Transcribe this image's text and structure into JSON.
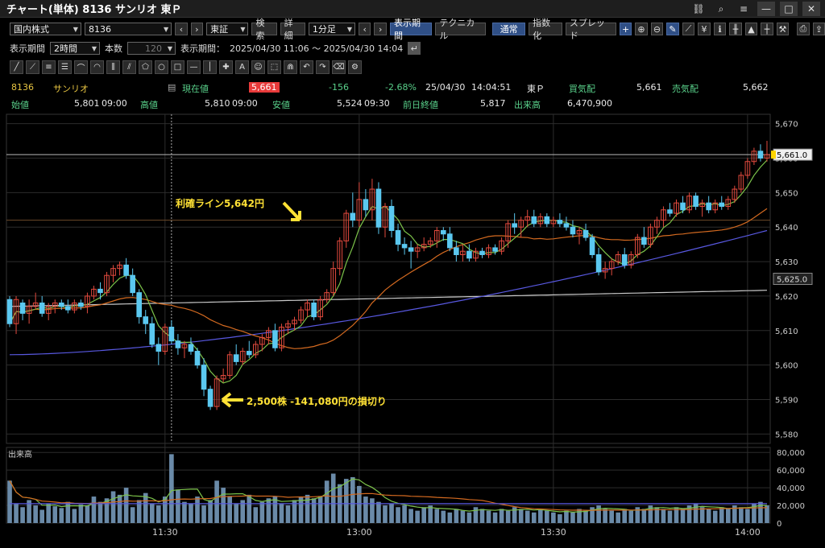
{
  "window": {
    "title": "チャート(単体) 8136 サンリオ 東Ｐ",
    "icons": [
      "link-icon",
      "search-icon",
      "menu-icon",
      "minimize-icon",
      "maximize-icon",
      "close-icon"
    ]
  },
  "toolbar1": {
    "market_select": "国内株式",
    "code_select": "8136",
    "exchange_select": "東証",
    "search_btn": "検索",
    "detail_btn": "詳細",
    "interval_select": "1分足",
    "period_btn": "表示期間",
    "technical_btn": "テクニカル",
    "normal_btn": "通常",
    "index_btn": "指数化",
    "spread_btn": "スプレッド"
  },
  "toolbar2": {
    "period_label": "表示期間",
    "period_value": "2時間",
    "count_label": "本数",
    "count_value": "120",
    "range_label": "表示期間：",
    "range_value": "2025/04/30 11:06 ～ 2025/04/30 14:04"
  },
  "quote1": {
    "code": "8136",
    "name": "サンリオ",
    "current_label": "現在値",
    "current_value": "5,661",
    "change": "-156",
    "change_pct": "-2.68%",
    "date": "25/04/30",
    "time": "14:04:51",
    "exchange": "東Ｐ",
    "bid_label": "買気配",
    "bid_value": "5,661",
    "ask_label": "売気配",
    "ask_value": "5,662"
  },
  "quote2": {
    "open_label": "始値",
    "open_value": "5,801",
    "open_time": "09:00",
    "high_label": "高値",
    "high_value": "5,810",
    "high_time": "09:00",
    "low_label": "安値",
    "low_value": "5,524",
    "low_time": "09:30",
    "prev_label": "前日終値",
    "prev_value": "5,817",
    "volume_label": "出来高",
    "volume_value": "6,470,900"
  },
  "annotations": {
    "take_profit": "利確ライン5,642円",
    "stop_loss": "2,500株 -141,080円の損切り"
  },
  "colors": {
    "up": "#e24a3e",
    "down": "#5bc8f0",
    "ma_short": "#7cc34a",
    "ma_mid": "#d46a20",
    "ma_long": "#5858e0",
    "ma_longest": "#c8c8c8",
    "annotation": "#ffe135"
  },
  "chart_data": {
    "type": "candlestick",
    "volume_label": "出来高",
    "price_ylim": [
      5578,
      5672
    ],
    "price_ticks": [
      "5,670",
      "5,660",
      "5,650",
      "5,640",
      "5,630",
      "5,620",
      "5,610",
      "5,600",
      "5,590",
      "5,580"
    ],
    "price_tick_values": [
      5670,
      5660,
      5650,
      5640,
      5630,
      5620,
      5610,
      5600,
      5590,
      5580
    ],
    "volume_ylim": [
      0,
      82000
    ],
    "volume_ticks": [
      "80,000",
      "60,000",
      "40,000",
      "20,000",
      "0"
    ],
    "volume_tick_values": [
      80000,
      60000,
      40000,
      20000,
      0
    ],
    "x_ticks": [
      "11:30",
      "13:00",
      "13:30",
      "14:00"
    ],
    "x_tick_index": [
      24,
      54,
      84,
      114
    ],
    "crosshair_index": 25,
    "price_marker": "5,661.0",
    "price_marker_value": 5661,
    "low_marker": "5,625.0",
    "low_marker_value": 5625,
    "take_profit_value": 5642,
    "candles": [
      [
        5619,
        5620,
        5611,
        5612
      ],
      [
        5612,
        5620,
        5609,
        5619
      ],
      [
        5618,
        5619,
        5613,
        5615
      ],
      [
        5615,
        5619,
        5612,
        5617
      ],
      [
        5617,
        5621,
        5616,
        5618
      ],
      [
        5618,
        5620,
        5614,
        5615
      ],
      [
        5615,
        5618,
        5613,
        5617
      ],
      [
        5617,
        5619,
        5615,
        5618
      ],
      [
        5618,
        5619,
        5616,
        5617
      ],
      [
        5617,
        5619,
        5615,
        5616
      ],
      [
        5616,
        5619,
        5615,
        5618
      ],
      [
        5618,
        5619,
        5616,
        5617
      ],
      [
        5617,
        5621,
        5615,
        5620
      ],
      [
        5620,
        5623,
        5619,
        5622
      ],
      [
        5622,
        5624,
        5619,
        5621
      ],
      [
        5621,
        5627,
        5620,
        5626
      ],
      [
        5626,
        5629,
        5624,
        5628
      ],
      [
        5628,
        5630,
        5626,
        5629
      ],
      [
        5629,
        5631,
        5625,
        5626
      ],
      [
        5626,
        5628,
        5620,
        5621
      ],
      [
        5621,
        5622,
        5612,
        5614
      ],
      [
        5614,
        5616,
        5609,
        5612
      ],
      [
        5612,
        5614,
        5605,
        5606
      ],
      [
        5606,
        5608,
        5600,
        5604
      ],
      [
        5604,
        5612,
        5603,
        5611
      ],
      [
        5611,
        5613,
        5606,
        5607
      ],
      [
        5607,
        5609,
        5603,
        5605
      ],
      [
        5605,
        5607,
        5602,
        5606
      ],
      [
        5606,
        5608,
        5603,
        5604
      ],
      [
        5604,
        5605,
        5599,
        5600
      ],
      [
        5600,
        5602,
        5591,
        5593
      ],
      [
        5593,
        5594,
        5587,
        5588
      ],
      [
        5588,
        5597,
        5587,
        5596
      ],
      [
        5596,
        5599,
        5595,
        5597
      ],
      [
        5597,
        5604,
        5596,
        5603
      ],
      [
        5603,
        5606,
        5600,
        5601
      ],
      [
        5601,
        5605,
        5600,
        5604
      ],
      [
        5604,
        5607,
        5602,
        5603
      ],
      [
        5603,
        5607,
        5602,
        5606
      ],
      [
        5606,
        5609,
        5604,
        5608
      ],
      [
        5608,
        5611,
        5606,
        5610
      ],
      [
        5610,
        5612,
        5604,
        5605
      ],
      [
        5605,
        5612,
        5604,
        5611
      ],
      [
        5611,
        5613,
        5609,
        5612
      ],
      [
        5612,
        5614,
        5610,
        5613
      ],
      [
        5613,
        5617,
        5612,
        5616
      ],
      [
        5616,
        5619,
        5614,
        5618
      ],
      [
        5618,
        5619,
        5613,
        5614
      ],
      [
        5614,
        5620,
        5613,
        5619
      ],
      [
        5619,
        5622,
        5618,
        5621
      ],
      [
        5621,
        5630,
        5620,
        5628
      ],
      [
        5628,
        5637,
        5626,
        5636
      ],
      [
        5636,
        5645,
        5634,
        5644
      ],
      [
        5644,
        5650,
        5640,
        5642
      ],
      [
        5642,
        5653,
        5640,
        5648
      ],
      [
        5648,
        5651,
        5643,
        5645
      ],
      [
        5645,
        5654,
        5642,
        5651
      ],
      [
        5651,
        5653,
        5638,
        5640
      ],
      [
        5640,
        5647,
        5637,
        5646
      ],
      [
        5646,
        5648,
        5637,
        5639
      ],
      [
        5639,
        5641,
        5633,
        5635
      ],
      [
        5635,
        5637,
        5632,
        5634
      ],
      [
        5634,
        5636,
        5628,
        5633
      ],
      [
        5633,
        5635,
        5631,
        5634
      ],
      [
        5634,
        5637,
        5633,
        5635
      ],
      [
        5635,
        5637,
        5634,
        5636
      ],
      [
        5636,
        5640,
        5634,
        5639
      ],
      [
        5639,
        5640,
        5636,
        5638
      ],
      [
        5638,
        5640,
        5633,
        5634
      ],
      [
        5634,
        5636,
        5630,
        5632
      ],
      [
        5632,
        5635,
        5630,
        5633
      ],
      [
        5633,
        5635,
        5630,
        5631
      ],
      [
        5631,
        5634,
        5630,
        5633
      ],
      [
        5633,
        5634,
        5631,
        5632
      ],
      [
        5632,
        5635,
        5631,
        5634
      ],
      [
        5634,
        5635,
        5632,
        5633
      ],
      [
        5633,
        5637,
        5632,
        5636
      ],
      [
        5636,
        5642,
        5634,
        5641
      ],
      [
        5641,
        5644,
        5638,
        5640
      ],
      [
        5640,
        5643,
        5637,
        5642
      ],
      [
        5642,
        5645,
        5640,
        5643
      ],
      [
        5643,
        5645,
        5640,
        5641
      ],
      [
        5641,
        5644,
        5640,
        5643
      ],
      [
        5643,
        5644,
        5640,
        5641
      ],
      [
        5641,
        5643,
        5640,
        5642
      ],
      [
        5642,
        5644,
        5640,
        5641
      ],
      [
        5641,
        5643,
        5639,
        5640
      ],
      [
        5640,
        5642,
        5637,
        5638
      ],
      [
        5638,
        5640,
        5635,
        5639
      ],
      [
        5639,
        5641,
        5636,
        5637
      ],
      [
        5637,
        5638,
        5631,
        5632
      ],
      [
        5632,
        5634,
        5626,
        5627
      ],
      [
        5627,
        5630,
        5625,
        5628
      ],
      [
        5628,
        5631,
        5626,
        5630
      ],
      [
        5630,
        5633,
        5629,
        5632
      ],
      [
        5632,
        5634,
        5628,
        5629
      ],
      [
        5629,
        5633,
        5628,
        5632
      ],
      [
        5632,
        5638,
        5631,
        5637
      ],
      [
        5637,
        5640,
        5634,
        5635
      ],
      [
        5635,
        5641,
        5634,
        5640
      ],
      [
        5640,
        5643,
        5638,
        5642
      ],
      [
        5642,
        5646,
        5640,
        5645
      ],
      [
        5645,
        5647,
        5643,
        5644
      ],
      [
        5644,
        5648,
        5643,
        5647
      ],
      [
        5647,
        5649,
        5644,
        5645
      ],
      [
        5645,
        5650,
        5644,
        5649
      ],
      [
        5649,
        5650,
        5645,
        5646
      ],
      [
        5646,
        5648,
        5643,
        5647
      ],
      [
        5647,
        5649,
        5644,
        5645
      ],
      [
        5645,
        5648,
        5644,
        5647
      ],
      [
        5647,
        5649,
        5645,
        5646
      ],
      [
        5646,
        5649,
        5645,
        5648
      ],
      [
        5648,
        5652,
        5647,
        5651
      ],
      [
        5651,
        5656,
        5650,
        5655
      ],
      [
        5655,
        5660,
        5654,
        5659
      ],
      [
        5659,
        5663,
        5658,
        5662
      ],
      [
        5662,
        5664,
        5659,
        5660
      ],
      [
        5660,
        5665,
        5659,
        5661
      ]
    ],
    "volume": [
      48000,
      22000,
      18000,
      26000,
      20000,
      15000,
      22000,
      19000,
      17000,
      24000,
      16000,
      21000,
      20000,
      30000,
      24000,
      28000,
      36000,
      32000,
      40000,
      18000,
      26000,
      34000,
      22000,
      20000,
      30000,
      78000,
      38000,
      24000,
      22000,
      30000,
      20000,
      26000,
      48000,
      40000,
      30000,
      22000,
      26000,
      32000,
      18000,
      24000,
      28000,
      30000,
      22000,
      20000,
      26000,
      30000,
      32000,
      28000,
      30000,
      48000,
      56000,
      44000,
      50000,
      52000,
      42000,
      30000,
      28000,
      24000,
      20000,
      22000,
      18000,
      20000,
      16000,
      14000,
      18000,
      20000,
      16000,
      14000,
      12000,
      16000,
      14000,
      12000,
      18000,
      16000,
      14000,
      12000,
      16000,
      14000,
      18000,
      16000,
      14000,
      12000,
      16000,
      14000,
      12000,
      10000,
      14000,
      12000,
      16000,
      14000,
      18000,
      20000,
      16000,
      14000,
      12000,
      16000,
      14000,
      18000,
      16000,
      20000,
      18000,
      16000,
      14000,
      18000,
      16000,
      20000,
      22000,
      18000,
      16000,
      14000,
      18000,
      16000,
      20000,
      18000,
      16000,
      22000,
      24000,
      20000
    ]
  }
}
